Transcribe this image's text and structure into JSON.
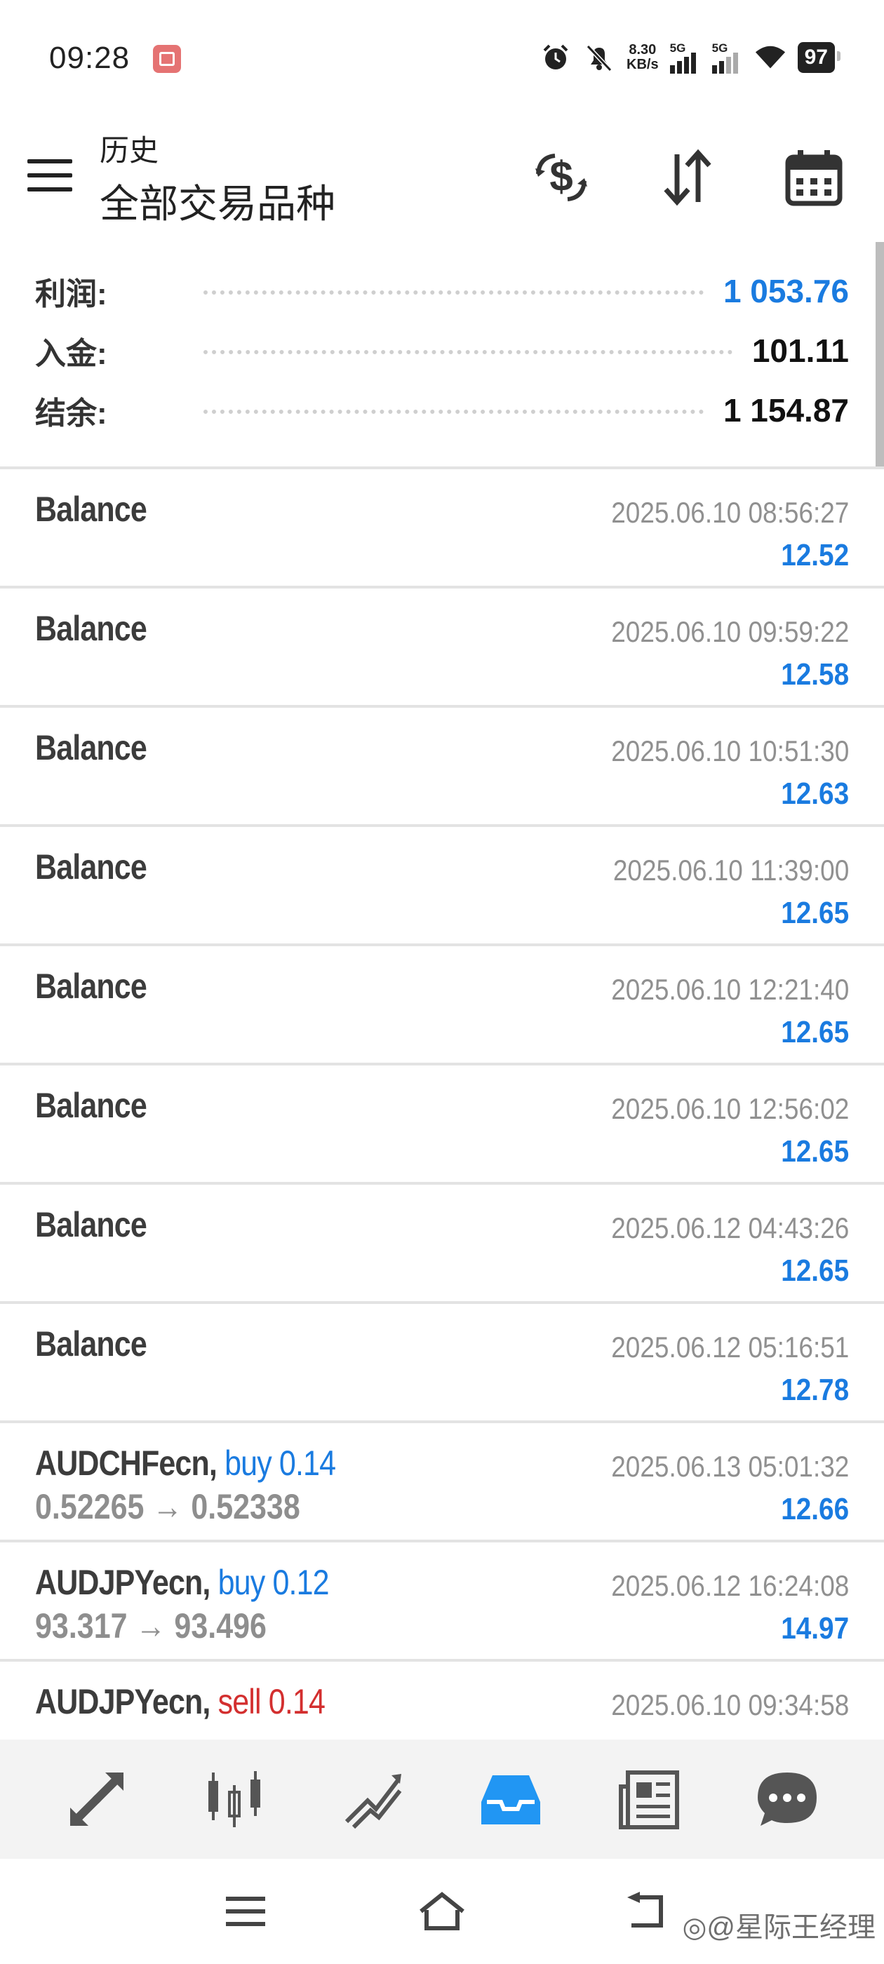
{
  "status_bar": {
    "time": "09:28",
    "speed_value": "8.30",
    "speed_unit": "KB/s",
    "signal1_label": "5G",
    "signal2_label": "5G",
    "battery": "97"
  },
  "header": {
    "subtitle": "历史",
    "title": "全部交易品种",
    "icons": [
      "currency-exchange-icon",
      "sort-icon",
      "calendar-icon"
    ]
  },
  "summary": {
    "profit_label": "利润:",
    "profit_value": "1 053.76",
    "deposit_label": "入金:",
    "deposit_value": "101.11",
    "balance_label": "结余:",
    "balance_value": "1 154.87"
  },
  "rows": [
    {
      "title": "Balance",
      "date": "2025.06.10 08:56:27",
      "amount": "12.52"
    },
    {
      "title": "Balance",
      "date": "2025.06.10 09:59:22",
      "amount": "12.58"
    },
    {
      "title": "Balance",
      "date": "2025.06.10 10:51:30",
      "amount": "12.63"
    },
    {
      "title": "Balance",
      "date": "2025.06.10 11:39:00",
      "amount": "12.65"
    },
    {
      "title": "Balance",
      "date": "2025.06.10 12:21:40",
      "amount": "12.65"
    },
    {
      "title": "Balance",
      "date": "2025.06.10 12:56:02",
      "amount": "12.65"
    },
    {
      "title": "Balance",
      "date": "2025.06.12 04:43:26",
      "amount": "12.65"
    },
    {
      "title": "Balance",
      "date": "2025.06.12 05:16:51",
      "amount": "12.78"
    },
    {
      "title": "AUDCHFecn,",
      "side": "buy 0.14",
      "prices": "0.52265 → 0.52338",
      "date": "2025.06.13 05:01:32",
      "amount": "12.66"
    },
    {
      "title": "AUDJPYecn,",
      "side": "buy 0.12",
      "prices": "93.317 → 93.496",
      "date": "2025.06.12 16:24:08",
      "amount": "14.97"
    },
    {
      "title": "AUDJPYecn,",
      "side": "sell 0.14",
      "date": "2025.06.10 09:34:58"
    }
  ],
  "bottom_nav": [
    "quotes-icon",
    "chart-icon",
    "trade-icon",
    "history-icon",
    "news-icon",
    "messages-icon"
  ],
  "colors": {
    "accent": "#1a7be0",
    "sell": "#d32f2f",
    "active_nav": "#2196f3"
  },
  "watermark": "◎@星际王经理"
}
